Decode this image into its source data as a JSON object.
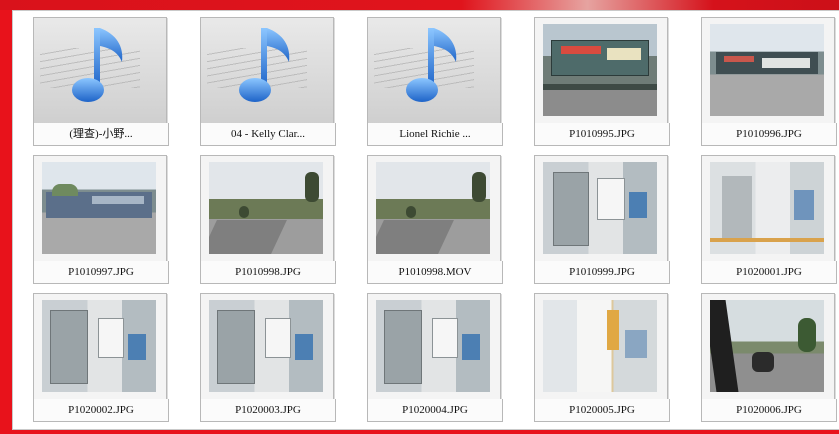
{
  "files": [
    {
      "name": "(理查)-小野...",
      "kind": "audio",
      "icon": "music-note-icon"
    },
    {
      "name": "04 - Kelly Clar...",
      "kind": "audio",
      "icon": "music-note-icon"
    },
    {
      "name": "Lionel Richie ...",
      "kind": "audio",
      "icon": "music-note-icon"
    },
    {
      "name": "P1010995.JPG",
      "kind": "photo",
      "icon": "photo-thumbnail"
    },
    {
      "name": "P1010996.JPG",
      "kind": "photo",
      "icon": "photo-thumbnail"
    },
    {
      "name": "P1010997.JPG",
      "kind": "photo",
      "icon": "photo-thumbnail"
    },
    {
      "name": "P1010998.JPG",
      "kind": "photo",
      "icon": "photo-thumbnail"
    },
    {
      "name": "P1010998.MOV",
      "kind": "video",
      "icon": "video-thumbnail"
    },
    {
      "name": "P1010999.JPG",
      "kind": "photo",
      "icon": "photo-thumbnail"
    },
    {
      "name": "P1020001.JPG",
      "kind": "photo",
      "icon": "photo-thumbnail"
    },
    {
      "name": "P1020002.JPG",
      "kind": "photo",
      "icon": "photo-thumbnail"
    },
    {
      "name": "P1020003.JPG",
      "kind": "photo",
      "icon": "photo-thumbnail"
    },
    {
      "name": "P1020004.JPG",
      "kind": "photo",
      "icon": "photo-thumbnail"
    },
    {
      "name": "P1020005.JPG",
      "kind": "photo",
      "icon": "photo-thumbnail"
    },
    {
      "name": "P1020006.JPG",
      "kind": "photo",
      "icon": "photo-thumbnail"
    }
  ],
  "colors": {
    "border_red": "#e8121b",
    "note_blue": "#2f7fd6"
  }
}
